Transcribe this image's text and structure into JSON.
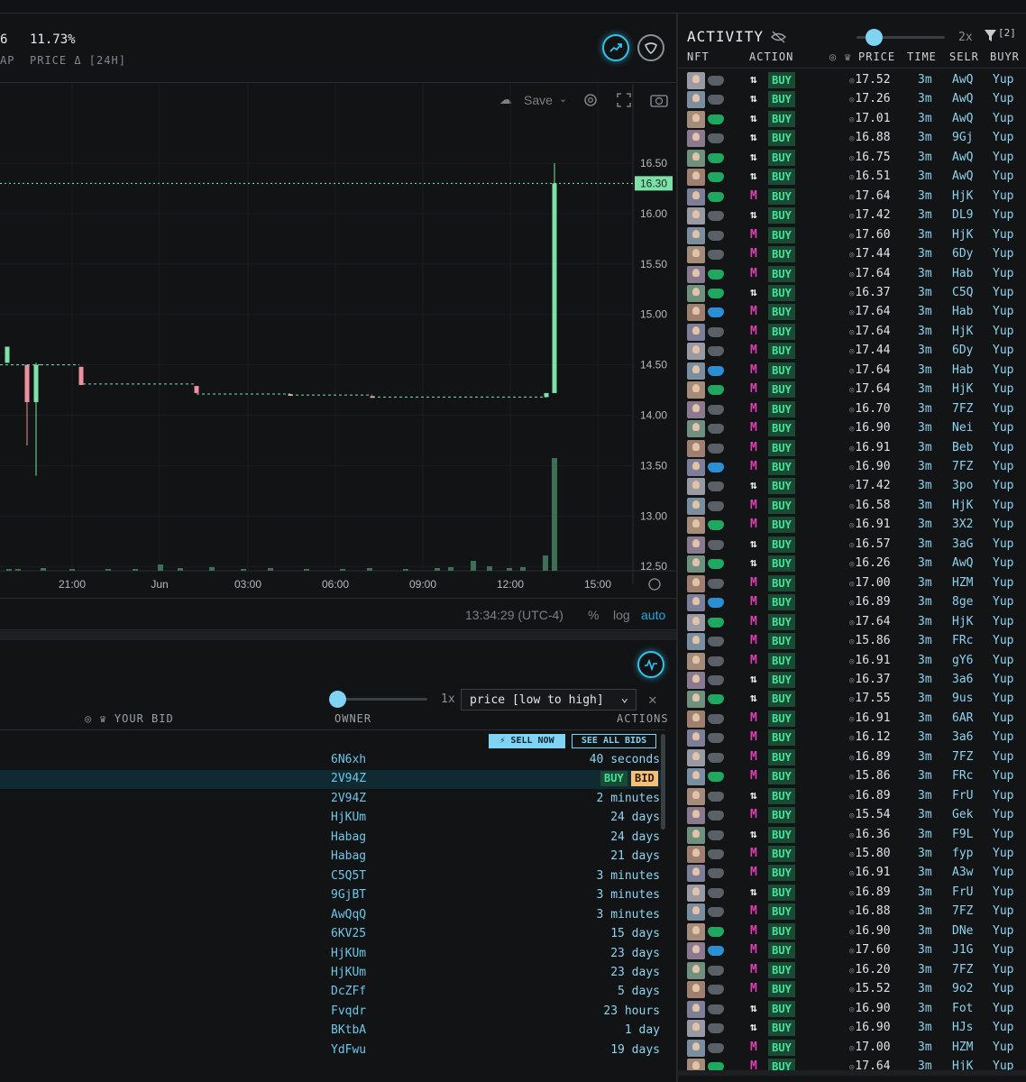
{
  "header": {
    "stat1_value": "6",
    "stat1_label": "AP",
    "stat2_value": "11.73%",
    "stat2_label": "PRICE Δ [24H]"
  },
  "chart_toolbar": {
    "save_label": "Save"
  },
  "price_chart": {
    "current_price_label": "16.30",
    "price_ticks": [
      "16.50",
      "16.00",
      "15.50",
      "15.00",
      "14.50",
      "14.00",
      "13.50",
      "13.00",
      "12.50"
    ],
    "time_ticks": [
      "21:00",
      "Jun",
      "03:00",
      "06:00",
      "09:00",
      "12:00",
      "15:00"
    ],
    "clock": "13:34:29 (UTC-4)",
    "scale_percent": "%",
    "scale_log": "log",
    "scale_auto": "auto",
    "colors": {
      "up": "#7ee2a8",
      "down": "#f08fa0",
      "accent": "#33c3ea"
    }
  },
  "bids": {
    "speed_label": "1x",
    "sort_select": "price [low to high]",
    "header_your_bid": "YOUR BID",
    "header_owner": "OWNER",
    "header_actions": "ACTIONS",
    "sell_now_label": "⚡ SELL NOW",
    "see_all_bids_label": "SEE ALL BIDS",
    "buy_label": "BUY",
    "bid_label": "BID",
    "rows": [
      {
        "owner": "6N6xh",
        "time": "40 seconds"
      },
      {
        "owner": "2V94Z",
        "time": ""
      },
      {
        "owner": "2V94Z",
        "time": "2 minutes"
      },
      {
        "owner": "HjKUm",
        "time": "24 days"
      },
      {
        "owner": "Habag",
        "time": "24 days"
      },
      {
        "owner": "Habag",
        "time": "21 days"
      },
      {
        "owner": "C5Q5T",
        "time": "3 minutes"
      },
      {
        "owner": "9GjBT",
        "time": "3 minutes"
      },
      {
        "owner": "AwQqQ",
        "time": "3 minutes"
      },
      {
        "owner": "6KV25",
        "time": "15 days"
      },
      {
        "owner": "HjKUm",
        "time": "23 days"
      },
      {
        "owner": "HjKUm",
        "time": "23 days"
      },
      {
        "owner": "DcZFf",
        "time": "5 days"
      },
      {
        "owner": "Fvqdr",
        "time": "23 hours"
      },
      {
        "owner": "BKtbA",
        "time": "1 day"
      },
      {
        "owner": "YdFwu",
        "time": "19 days"
      }
    ]
  },
  "activity": {
    "title": "ACTIVITY",
    "speed_label": "2x",
    "filter_count": "[2]",
    "columns": {
      "nft": "NFT",
      "action": "ACTION",
      "price": "PRICE",
      "time": "TIME",
      "seller": "SELR",
      "buyer": "BUYR"
    },
    "rows": [
      {
        "m": "t",
        "s": "g",
        "a": "BUY",
        "p": "17.52",
        "t": "3m",
        "sl": "AwQ",
        "b": "Yup"
      },
      {
        "m": "t",
        "s": "g",
        "a": "BUY",
        "p": "17.26",
        "t": "3m",
        "sl": "AwQ",
        "b": "Yup"
      },
      {
        "m": "t",
        "s": "e",
        "a": "BUY",
        "p": "17.01",
        "t": "3m",
        "sl": "AwQ",
        "b": "Yup"
      },
      {
        "m": "t",
        "s": "g",
        "a": "BUY",
        "p": "16.88",
        "t": "3m",
        "sl": "9Gj",
        "b": "Yup"
      },
      {
        "m": "t",
        "s": "e",
        "a": "BUY",
        "p": "16.75",
        "t": "3m",
        "sl": "AwQ",
        "b": "Yup"
      },
      {
        "m": "t",
        "s": "e",
        "a": "BUY",
        "p": "16.51",
        "t": "3m",
        "sl": "AwQ",
        "b": "Yup"
      },
      {
        "m": "m",
        "s": "e",
        "a": "BUY",
        "p": "17.64",
        "t": "3m",
        "sl": "HjK",
        "b": "Yup"
      },
      {
        "m": "t",
        "s": "g",
        "a": "BUY",
        "p": "17.42",
        "t": "3m",
        "sl": "DL9",
        "b": "Yup"
      },
      {
        "m": "m",
        "s": "g",
        "a": "BUY",
        "p": "17.60",
        "t": "3m",
        "sl": "HjK",
        "b": "Yup"
      },
      {
        "m": "m",
        "s": "g",
        "a": "BUY",
        "p": "17.44",
        "t": "3m",
        "sl": "6Dy",
        "b": "Yup"
      },
      {
        "m": "m",
        "s": "e",
        "a": "BUY",
        "p": "17.64",
        "t": "3m",
        "sl": "Hab",
        "b": "Yup"
      },
      {
        "m": "t",
        "s": "e",
        "a": "BUY",
        "p": "16.37",
        "t": "3m",
        "sl": "C5Q",
        "b": "Yup"
      },
      {
        "m": "m",
        "s": "b",
        "a": "BUY",
        "p": "17.64",
        "t": "3m",
        "sl": "Hab",
        "b": "Yup"
      },
      {
        "m": "m",
        "s": "g",
        "a": "BUY",
        "p": "17.64",
        "t": "3m",
        "sl": "HjK",
        "b": "Yup"
      },
      {
        "m": "m",
        "s": "g",
        "a": "BUY",
        "p": "17.44",
        "t": "3m",
        "sl": "6Dy",
        "b": "Yup"
      },
      {
        "m": "m",
        "s": "b",
        "a": "BUY",
        "p": "17.64",
        "t": "3m",
        "sl": "Hab",
        "b": "Yup"
      },
      {
        "m": "m",
        "s": "e",
        "a": "BUY",
        "p": "17.64",
        "t": "3m",
        "sl": "HjK",
        "b": "Yup"
      },
      {
        "m": "m",
        "s": "g",
        "a": "BUY",
        "p": "16.70",
        "t": "3m",
        "sl": "7FZ",
        "b": "Yup"
      },
      {
        "m": "m",
        "s": "g",
        "a": "BUY",
        "p": "16.90",
        "t": "3m",
        "sl": "Nei",
        "b": "Yup"
      },
      {
        "m": "m",
        "s": "g",
        "a": "BUY",
        "p": "16.91",
        "t": "3m",
        "sl": "Beb",
        "b": "Yup"
      },
      {
        "m": "m",
        "s": "b",
        "a": "BUY",
        "p": "16.90",
        "t": "3m",
        "sl": "7FZ",
        "b": "Yup"
      },
      {
        "m": "t",
        "s": "g",
        "a": "BUY",
        "p": "17.42",
        "t": "3m",
        "sl": "3po",
        "b": "Yup"
      },
      {
        "m": "m",
        "s": "g",
        "a": "BUY",
        "p": "16.58",
        "t": "3m",
        "sl": "HjK",
        "b": "Yup"
      },
      {
        "m": "m",
        "s": "e",
        "a": "BUY",
        "p": "16.91",
        "t": "3m",
        "sl": "3X2",
        "b": "Yup"
      },
      {
        "m": "t",
        "s": "g",
        "a": "BUY",
        "p": "16.57",
        "t": "3m",
        "sl": "3aG",
        "b": "Yup"
      },
      {
        "m": "t",
        "s": "e",
        "a": "BUY",
        "p": "16.26",
        "t": "3m",
        "sl": "AwQ",
        "b": "Yup"
      },
      {
        "m": "m",
        "s": "g",
        "a": "BUY",
        "p": "17.00",
        "t": "3m",
        "sl": "HZM",
        "b": "Yup"
      },
      {
        "m": "m",
        "s": "b",
        "a": "BUY",
        "p": "16.89",
        "t": "3m",
        "sl": "8ge",
        "b": "Yup"
      },
      {
        "m": "m",
        "s": "e",
        "a": "BUY",
        "p": "17.64",
        "t": "3m",
        "sl": "HjK",
        "b": "Yup"
      },
      {
        "m": "m",
        "s": "g",
        "a": "BUY",
        "p": "15.86",
        "t": "3m",
        "sl": "FRc",
        "b": "Yup"
      },
      {
        "m": "m",
        "s": "g",
        "a": "BUY",
        "p": "16.91",
        "t": "3m",
        "sl": "gY6",
        "b": "Yup"
      },
      {
        "m": "t",
        "s": "g",
        "a": "BUY",
        "p": "16.37",
        "t": "3m",
        "sl": "3a6",
        "b": "Yup"
      },
      {
        "m": "t",
        "s": "e",
        "a": "BUY",
        "p": "17.55",
        "t": "3m",
        "sl": "9us",
        "b": "Yup"
      },
      {
        "m": "m",
        "s": "g",
        "a": "BUY",
        "p": "16.91",
        "t": "3m",
        "sl": "6AR",
        "b": "Yup"
      },
      {
        "m": "m",
        "s": "g",
        "a": "BUY",
        "p": "16.12",
        "t": "3m",
        "sl": "3a6",
        "b": "Yup"
      },
      {
        "m": "m",
        "s": "g",
        "a": "BUY",
        "p": "16.89",
        "t": "3m",
        "sl": "7FZ",
        "b": "Yup"
      },
      {
        "m": "m",
        "s": "e",
        "a": "BUY",
        "p": "15.86",
        "t": "3m",
        "sl": "FRc",
        "b": "Yup"
      },
      {
        "m": "t",
        "s": "g",
        "a": "BUY",
        "p": "16.89",
        "t": "3m",
        "sl": "FrU",
        "b": "Yup"
      },
      {
        "m": "m",
        "s": "g",
        "a": "BUY",
        "p": "15.54",
        "t": "3m",
        "sl": "Gek",
        "b": "Yup"
      },
      {
        "m": "t",
        "s": "g",
        "a": "BUY",
        "p": "16.36",
        "t": "3m",
        "sl": "F9L",
        "b": "Yup"
      },
      {
        "m": "m",
        "s": "g",
        "a": "BUY",
        "p": "15.80",
        "t": "3m",
        "sl": "fyp",
        "b": "Yup"
      },
      {
        "m": "m",
        "s": "g",
        "a": "BUY",
        "p": "16.91",
        "t": "3m",
        "sl": "A3w",
        "b": "Yup"
      },
      {
        "m": "t",
        "s": "g",
        "a": "BUY",
        "p": "16.89",
        "t": "3m",
        "sl": "FrU",
        "b": "Yup"
      },
      {
        "m": "m",
        "s": "g",
        "a": "BUY",
        "p": "16.88",
        "t": "3m",
        "sl": "7FZ",
        "b": "Yup"
      },
      {
        "m": "m",
        "s": "e",
        "a": "BUY",
        "p": "16.90",
        "t": "3m",
        "sl": "DNe",
        "b": "Yup"
      },
      {
        "m": "m",
        "s": "b",
        "a": "BUY",
        "p": "17.60",
        "t": "3m",
        "sl": "J1G",
        "b": "Yup"
      },
      {
        "m": "m",
        "s": "g",
        "a": "BUY",
        "p": "16.20",
        "t": "3m",
        "sl": "7FZ",
        "b": "Yup"
      },
      {
        "m": "m",
        "s": "g",
        "a": "BUY",
        "p": "15.52",
        "t": "3m",
        "sl": "9o2",
        "b": "Yup"
      },
      {
        "m": "t",
        "s": "g",
        "a": "BUY",
        "p": "16.90",
        "t": "3m",
        "sl": "Fot",
        "b": "Yup"
      },
      {
        "m": "t",
        "s": "g",
        "a": "BUY",
        "p": "16.90",
        "t": "3m",
        "sl": "HJs",
        "b": "Yup"
      },
      {
        "m": "m",
        "s": "g",
        "a": "BUY",
        "p": "17.00",
        "t": "3m",
        "sl": "HZM",
        "b": "Yup"
      },
      {
        "m": "m",
        "s": "e",
        "a": "BUY",
        "p": "17.64",
        "t": "3m",
        "sl": "HjK",
        "b": "Yup"
      }
    ]
  }
}
